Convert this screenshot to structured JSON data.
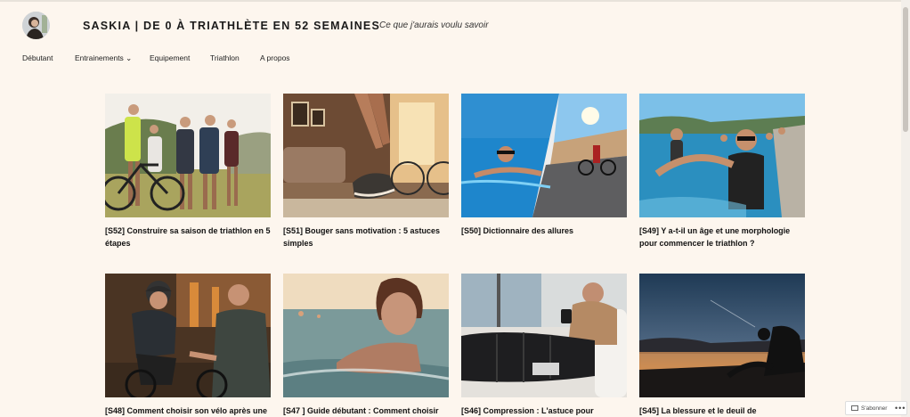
{
  "site": {
    "title": "SASKIA | DE 0 À TRIATHLÈTE EN 52 SEMAINES",
    "tagline": "Ce que j'aurais voulu savoir"
  },
  "nav": [
    {
      "label": "Débutant"
    },
    {
      "label": "Entrainements ⌄"
    },
    {
      "label": "Equipement"
    },
    {
      "label": "Triathlon"
    },
    {
      "label": "A propos"
    }
  ],
  "posts": [
    {
      "title": "[S52] Construire sa saison de triathlon en 5 étapes",
      "image": "group-cyclists-photo"
    },
    {
      "title": "[S51] Bouger sans motivation : 5 astuces simples",
      "image": "running-shoes-living-room-photo"
    },
    {
      "title": "[S50] Dictionnaire des allures",
      "image": "swimmer-cyclist-split-photo"
    },
    {
      "title": "[S49] Y a-t-il un âge et une morphologie pour commencer le triathlon ?",
      "image": "triathletes-lake-photo"
    },
    {
      "title": "[S48] Comment choisir son vélo après une",
      "image": "bike-fitting-photo"
    },
    {
      "title": "[S47 ] Guide débutant : Comment choisir",
      "image": "open-water-swimmer-photo"
    },
    {
      "title": "[S46] Compression : L'astuce pour",
      "image": "compression-boots-photo"
    },
    {
      "title": "[S45] La blessure et le deuil de",
      "image": "sunset-silhouette-photo"
    }
  ],
  "subscribe": {
    "label": "S'abonner",
    "more": "•••"
  }
}
